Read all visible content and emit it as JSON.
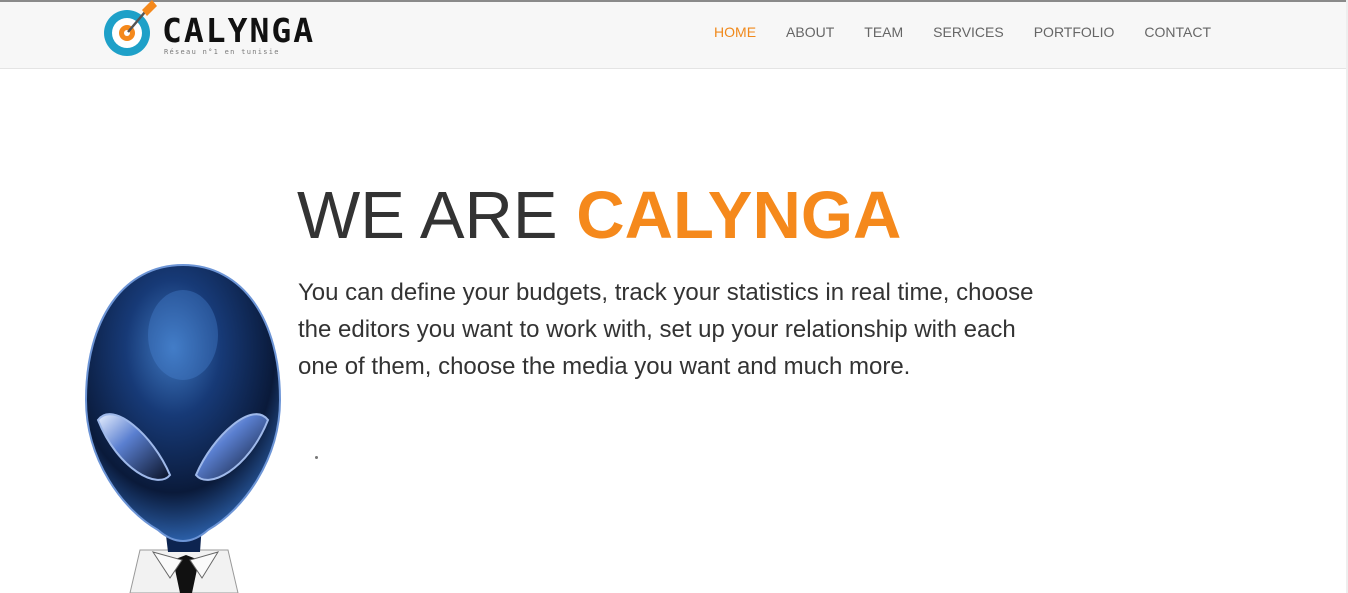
{
  "brand": {
    "name": "CALYNGA",
    "tagline": "Réseau n°1 en tunisie",
    "accent_color": "#f5891c",
    "logo_icon": "target-dart-icon"
  },
  "nav": {
    "items": [
      {
        "label": "HOME",
        "active": true
      },
      {
        "label": "ABOUT",
        "active": false
      },
      {
        "label": "TEAM",
        "active": false
      },
      {
        "label": "SERVICES",
        "active": false
      },
      {
        "label": "PORTFOLIO",
        "active": false
      },
      {
        "label": "CONTACT",
        "active": false
      }
    ]
  },
  "hero": {
    "title_prefix": "WE ARE",
    "title_highlight": "CALYNGA",
    "text": "You can define your budgets, track your statistics in real time, choose the editors you want to work with, set up your relationship with each one of them, choose the media you want and much more.",
    "image": "alien-mascot-illustration"
  }
}
